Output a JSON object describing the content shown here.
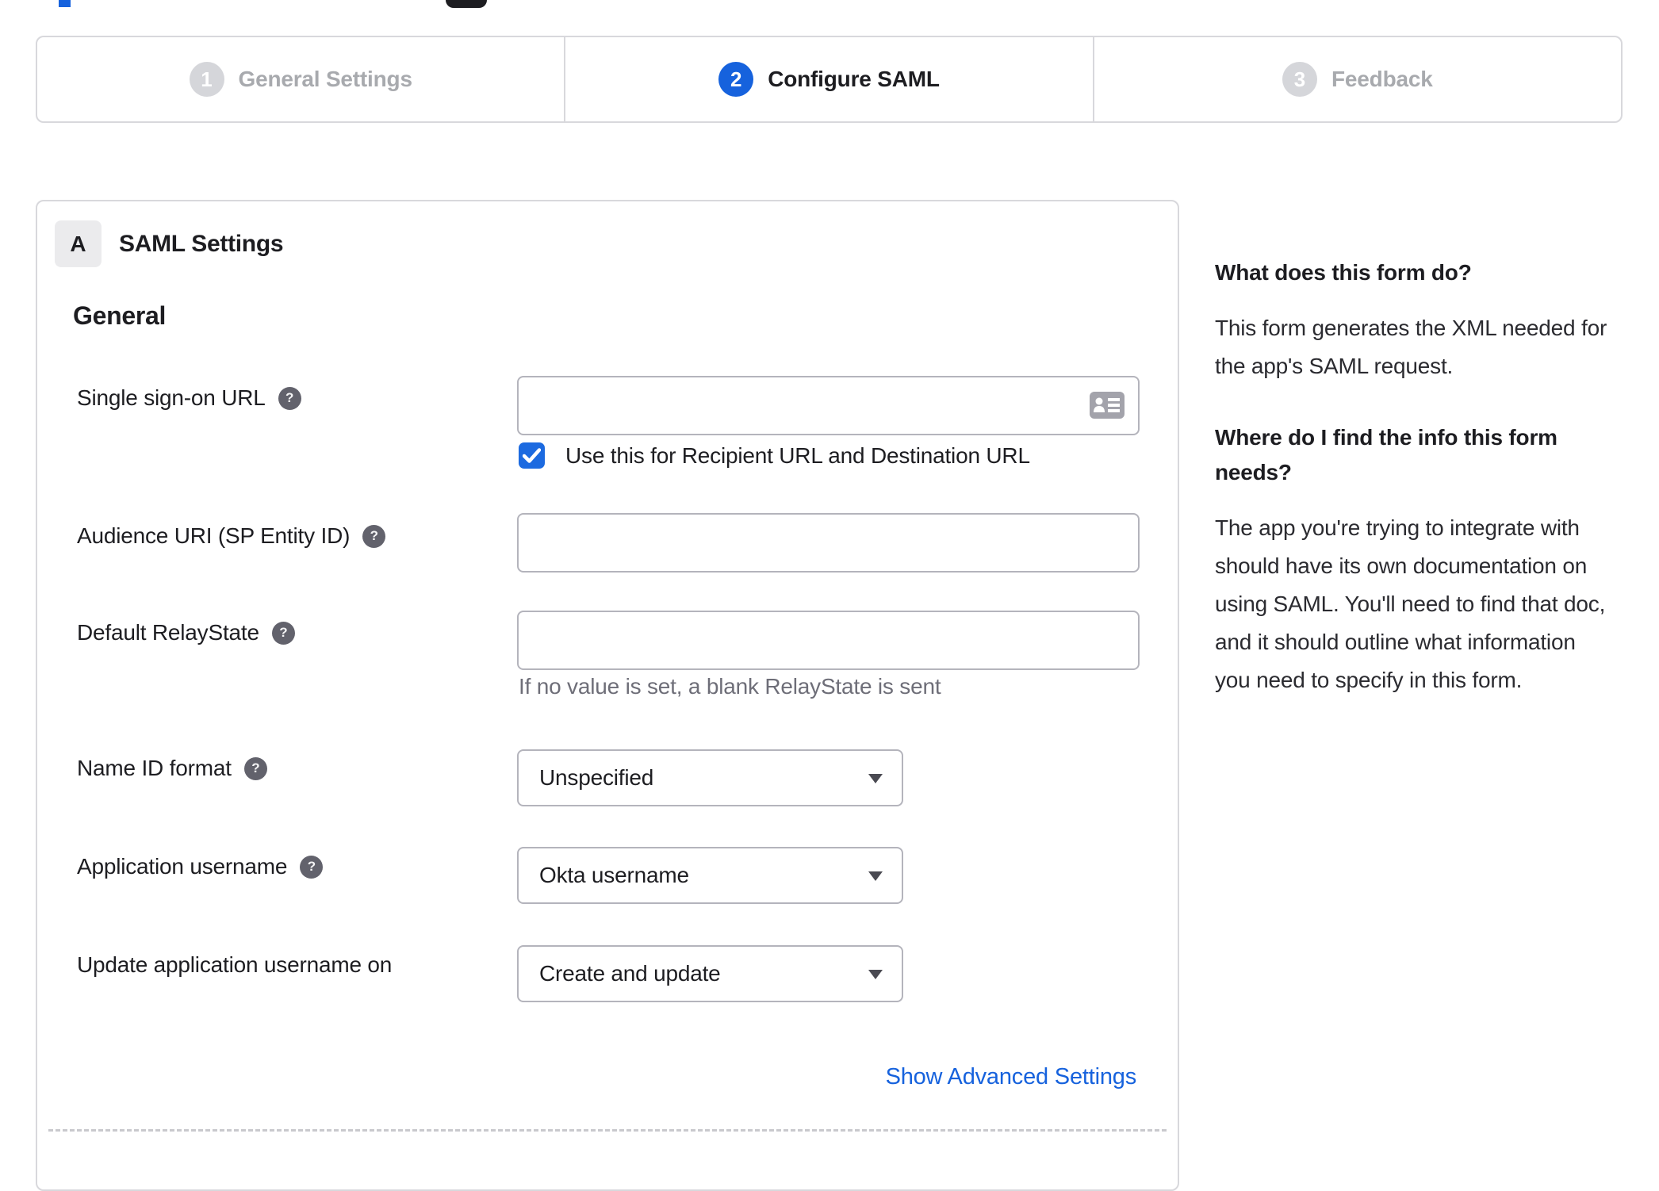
{
  "colors": {
    "accent_blue": "#1662dd",
    "checkbox_blue": "#1c6ae0",
    "border_gray": "#d8d8dc",
    "input_border_gray": "#b4b4bc",
    "inactive_gray": "#a8aaae",
    "hint_gray": "#6e6e78"
  },
  "icons": {
    "help_glyph": "?"
  },
  "stepper": {
    "steps": [
      {
        "number": "1",
        "label": "General Settings",
        "state": "inactive"
      },
      {
        "number": "2",
        "label": "Configure SAML",
        "state": "active"
      },
      {
        "number": "3",
        "label": "Feedback",
        "state": "inactive"
      }
    ]
  },
  "panel": {
    "badge": "A",
    "title": "SAML Settings",
    "section_title": "General",
    "fields": [
      {
        "label": "Single sign-on URL",
        "value": "",
        "checkbox_label": "Use this for Recipient URL and Destination URL",
        "checkbox_checked": true
      },
      {
        "label": "Audience URI (SP Entity ID)",
        "value": ""
      },
      {
        "label": "Default RelayState",
        "value": "",
        "hint": "If no value is set, a blank RelayState is sent"
      },
      {
        "label": "Name ID format",
        "value": "Unspecified",
        "type": "select"
      },
      {
        "label": "Application username",
        "value": "Okta username",
        "type": "select"
      },
      {
        "label": "Update application username on",
        "value": "Create and update",
        "type": "select"
      }
    ],
    "advanced_link": "Show Advanced Settings"
  },
  "help_panel": {
    "heading1": "What does this form do?",
    "body1": "This form generates the XML needed for the app's SAML request.",
    "heading2": "Where do I find the info this form needs?",
    "body2": "The app you're trying to integrate with should have its own documentation on using SAML. You'll need to find that doc, and it should outline what information you need to specify in this form."
  }
}
